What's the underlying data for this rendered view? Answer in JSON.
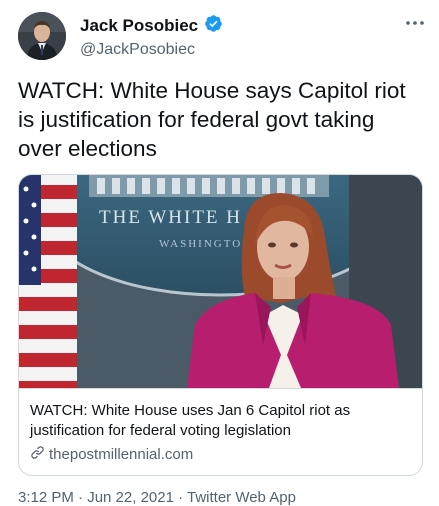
{
  "author": {
    "display_name": "Jack Posobiec",
    "handle": "@JackPosobiec",
    "verified_icon": "verified-badge-icon",
    "avatar_icon": "avatar"
  },
  "tweet": {
    "text": "WATCH: White House says Capitol riot is justification for federal govt taking over elections"
  },
  "link_card": {
    "image_text_line1": "THE WHITE H",
    "image_text_line2": "WASHINGTON",
    "title": "WATCH: White House uses Jan 6 Capitol riot as justification for federal voting legislation",
    "domain": "thepostmillennial.com",
    "domain_icon": "link-icon"
  },
  "meta": {
    "timestamp": "3:12 PM · Jun 22, 2021 · Twitter Web App"
  },
  "colors": {
    "verified_blue": "#1d9bf0",
    "secondary_text": "#536471",
    "border": "#cfd9de"
  }
}
